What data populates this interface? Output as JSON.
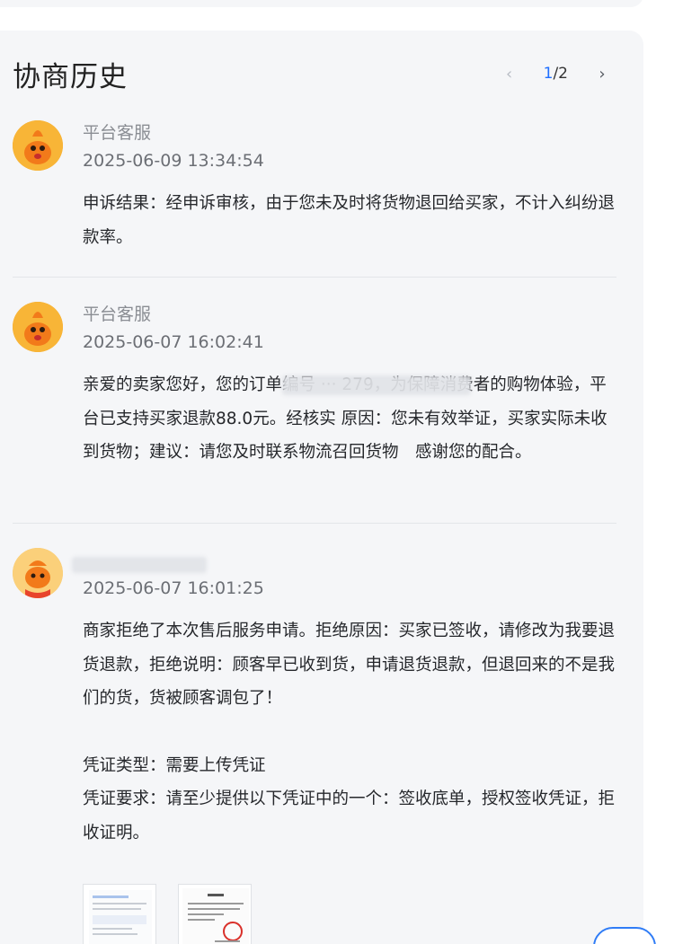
{
  "header": {
    "title": "协商历史",
    "pager": {
      "current": "1",
      "sep_total": "/2",
      "prev_icon": "‹",
      "next_icon": "›"
    }
  },
  "messages": [
    {
      "sender": "平台客服",
      "time": "2025-06-09 13:34:54",
      "body": [
        "申诉结果：经申诉审核，由于您未及时将货物退回给买家，不计入纠纷退款率。"
      ],
      "avatar": "mascot-avatar"
    },
    {
      "sender": "平台客服",
      "time": "2025-06-07 16:02:41",
      "body": [
        "亲爱的卖家您好，您的订单编号 ··· 279，为保障消费者的购物体验，平台已支持买家退款88.0元。经核实 原因：您未有效举证，买家实际未收到货物；建议：请您及时联系物流召回货物　感谢您的配合。"
      ],
      "avatar": "mascot-avatar"
    },
    {
      "sender": "",
      "time": "2025-06-07 16:01:25",
      "body": [
        "商家拒绝了本次售后服务申请。拒绝原因：买家已签收，请修改为我要退货退款，拒绝说明：顾客早已收到货，申请退货退款，但退回来的不是我们的货，货被顾客调包了！",
        "",
        "凭证类型：需要上传凭证",
        "凭证要求：请至少提供以下凭证中的一个：签收底单，授权签收凭证，拒收证明。"
      ],
      "avatar": "merchant-avatar"
    }
  ],
  "colors": {
    "accent": "#1f6fff",
    "panel_bg": "#f5f6f8",
    "avatar": "#f5a31c"
  }
}
